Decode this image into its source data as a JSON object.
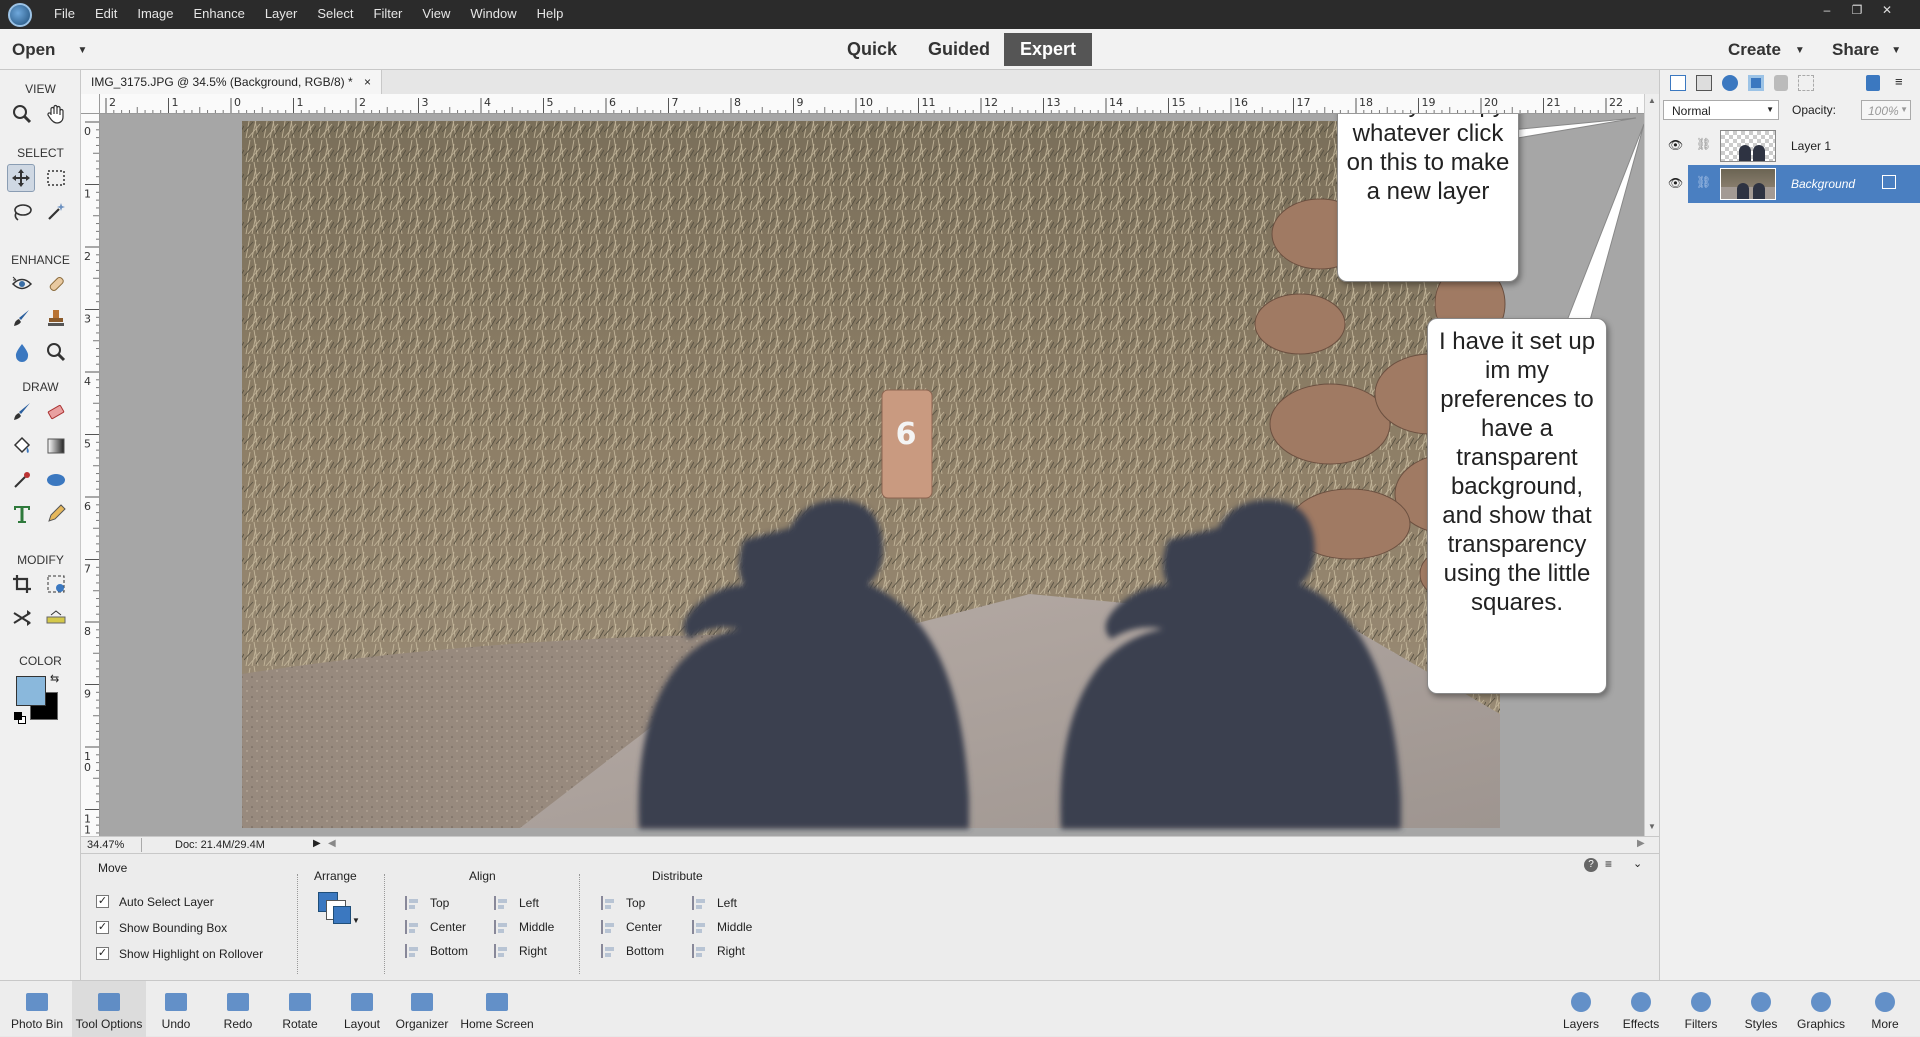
{
  "menubar": {
    "items": [
      "File",
      "Edit",
      "Image",
      "Enhance",
      "Layer",
      "Select",
      "Filter",
      "View",
      "Window",
      "Help"
    ],
    "controls": [
      "–",
      "❐",
      "✕"
    ]
  },
  "modebar": {
    "open_label": "Open",
    "modes": [
      "Quick",
      "Guided",
      "Expert"
    ],
    "active_mode": "Expert",
    "create_label": "Create",
    "share_label": "Share"
  },
  "toolbox": {
    "sections": {
      "view": "VIEW",
      "select": "SELECT",
      "enhance": "ENHANCE",
      "draw": "DRAW",
      "modify": "MODIFY",
      "color": "COLOR"
    },
    "foreground_color": "#8ab8dc",
    "background_color": "#000000"
  },
  "document": {
    "tab_title": "IMG_3175.JPG @ 34.5% (Background, RGB/8) *",
    "ruler_top": [
      "2",
      "1",
      "0",
      "1",
      "2",
      "3",
      "4",
      "5",
      "6",
      "7",
      "8",
      "9",
      "10",
      "11",
      "12",
      "13",
      "14",
      "15",
      "16",
      "17",
      "18",
      "19",
      "20",
      "21",
      "22"
    ],
    "ruler_left": [
      "0",
      "1",
      "2",
      "3",
      "4",
      "5",
      "6",
      "7",
      "8",
      "9",
      "1 0",
      "1 1"
    ],
    "zoom": "34.47%",
    "doc_info": "Doc: 21.4M/29.4M",
    "marker_digit": "6"
  },
  "callouts": {
    "new_layer": "After you copy whatever click on this to make a new layer",
    "transparency": "I have it set up im my preferences to have a transparent background, and show that transparency using the little squares."
  },
  "layers": {
    "blend_mode": "Normal",
    "opacity_label": "Opacity:",
    "opacity_value": "100%",
    "items": [
      {
        "name": "Layer 1",
        "selected": false
      },
      {
        "name": "Background",
        "selected": true
      }
    ]
  },
  "tool_options": {
    "tool_name": "Move",
    "checkboxes": [
      {
        "label": "Auto Select Layer",
        "checked": true
      },
      {
        "label": "Show Bounding Box",
        "checked": true
      },
      {
        "label": "Show Highlight on Rollover",
        "checked": true
      }
    ],
    "arrange_label": "Arrange",
    "align_label": "Align",
    "align_items": [
      "Top",
      "Center",
      "Bottom",
      "Left",
      "Middle",
      "Right"
    ],
    "distribute_label": "Distribute",
    "distribute_items": [
      "Top",
      "Center",
      "Bottom",
      "Left",
      "Middle",
      "Right"
    ]
  },
  "bottombar": {
    "left": [
      "Photo Bin",
      "Tool Options",
      "Undo",
      "Redo",
      "Rotate",
      "Layout",
      "Organizer",
      "Home Screen"
    ],
    "right": [
      "Layers",
      "Effects",
      "Filters",
      "Styles",
      "Graphics",
      "More"
    ]
  }
}
